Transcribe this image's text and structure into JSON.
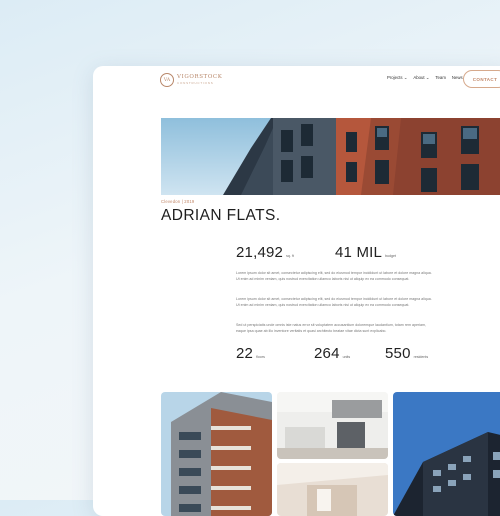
{
  "brand": {
    "mark": "VA",
    "name": "VIGORSTOCK",
    "tagline": "CONSTRUCTIONS"
  },
  "nav": {
    "items": [
      {
        "label": "Projects",
        "has_dropdown": true
      },
      {
        "label": "About",
        "has_dropdown": true
      },
      {
        "label": "Team",
        "has_dropdown": false
      },
      {
        "label": "News",
        "has_dropdown": false
      }
    ],
    "contact_label": "CONTACT"
  },
  "project": {
    "location": "Clevedon | 2019",
    "title": "ADRIAN FLATS."
  },
  "stats_top": [
    {
      "value": "21,492",
      "unit": "sq. ft"
    },
    {
      "value": "41 MIL",
      "unit": "budget"
    }
  ],
  "paragraphs": [
    "Lorem ipsum dolor sit amet, consectetur adipiscing elit, sed do eiusmod tempor incididunt ut labore et dolore magna aliqua. Ut enim ad minim veniam, quis nostrud exercitation ullamco laboris nisi ut aliquip ex ea commodo consequat.",
    "Lorem ipsum dolor sit amet, consectetur adipiscing elit, sed do eiusmod tempor incididunt ut labore et dolore magna aliqua. Ut enim ad minim veniam, quis nostrud exercitation ullamco laboris nisi ut aliquip ex ea commodo consequat.",
    "Sed ut perspiciatis unde omnis iste natus error sit voluptatem accusantium doloremque laudantium, totam rem aperiam, eaque ipsa quae ab illo inventore veritatis et quasi architecto beatae vitae dicta sunt explicabo."
  ],
  "stats_bottom": [
    {
      "value": "22",
      "unit": "floors"
    },
    {
      "value": "264",
      "unit": "units"
    },
    {
      "value": "550",
      "unit": "residents"
    }
  ],
  "colors": {
    "accent": "#c08566",
    "brick": "#9a4a34",
    "sky": "#a9cde3"
  }
}
